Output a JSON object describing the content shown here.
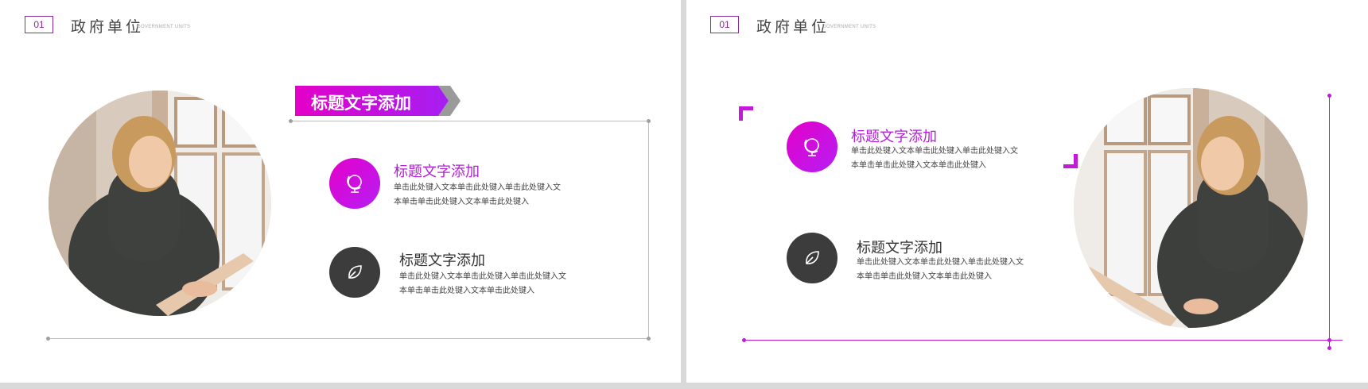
{
  "left_slide": {
    "header": {
      "number": "01",
      "title": "政府单位",
      "subtitle": "GOVERNMENT UNITS"
    },
    "banner": {
      "label": "标题文字添加"
    },
    "items": [
      {
        "icon": "globe-icon",
        "title": "标题文字添加",
        "body_line1": "单击此处键入文本单击此处键入单击此处键入文",
        "body_line2": "本单击单击此处键入文本单击此处键入"
      },
      {
        "icon": "leaf-icon",
        "title": "标题文字添加",
        "body_line1": "单击此处键入文本单击此处键入单击此处键入文",
        "body_line2": "本单击单击此处键入文本单击此处键入"
      }
    ]
  },
  "right_slide": {
    "header": {
      "number": "01",
      "title": "政府单位",
      "subtitle": "GOVERNMENT UNITS"
    },
    "items": [
      {
        "icon": "globe-icon",
        "title": "标题文字添加",
        "body_line1": "单击此处键入文本单击此处键入单击此处键入文",
        "body_line2": "本单击单击此处键入文本单击此处键入"
      },
      {
        "icon": "leaf-icon",
        "title": "标题文字添加",
        "body_line1": "单击此处键入文本单击此处键入单击此处键入文",
        "body_line2": "本单击单击此处键入文本单击此处键入"
      }
    ]
  },
  "colors": {
    "accent": "#b21fd4",
    "accent_pink": "#e400c8",
    "dark": "#3c3c3c",
    "line_gray": "#bdbdbd"
  }
}
